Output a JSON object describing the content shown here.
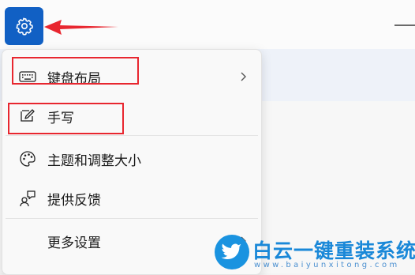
{
  "settings": {
    "icon": "gear-icon",
    "accent": "#1160c4"
  },
  "menu": {
    "items": [
      {
        "label": "键盘布局",
        "icon": "keyboard-icon",
        "has_submenu": true
      },
      {
        "label": "手写",
        "icon": "pen-icon",
        "has_submenu": false
      },
      {
        "label": "主题和调整大小",
        "icon": "palette-icon",
        "has_submenu": false
      },
      {
        "label": "提供反馈",
        "icon": "feedback-icon",
        "has_submenu": false
      },
      {
        "label": "更多设置",
        "icon": "",
        "has_submenu": true
      }
    ]
  },
  "annotation": {
    "color": "#e8262f"
  },
  "watermark": {
    "title": "白云一键重装系统",
    "url": "www.baiyunxitong.com",
    "icon": "twitter-bird-icon"
  }
}
